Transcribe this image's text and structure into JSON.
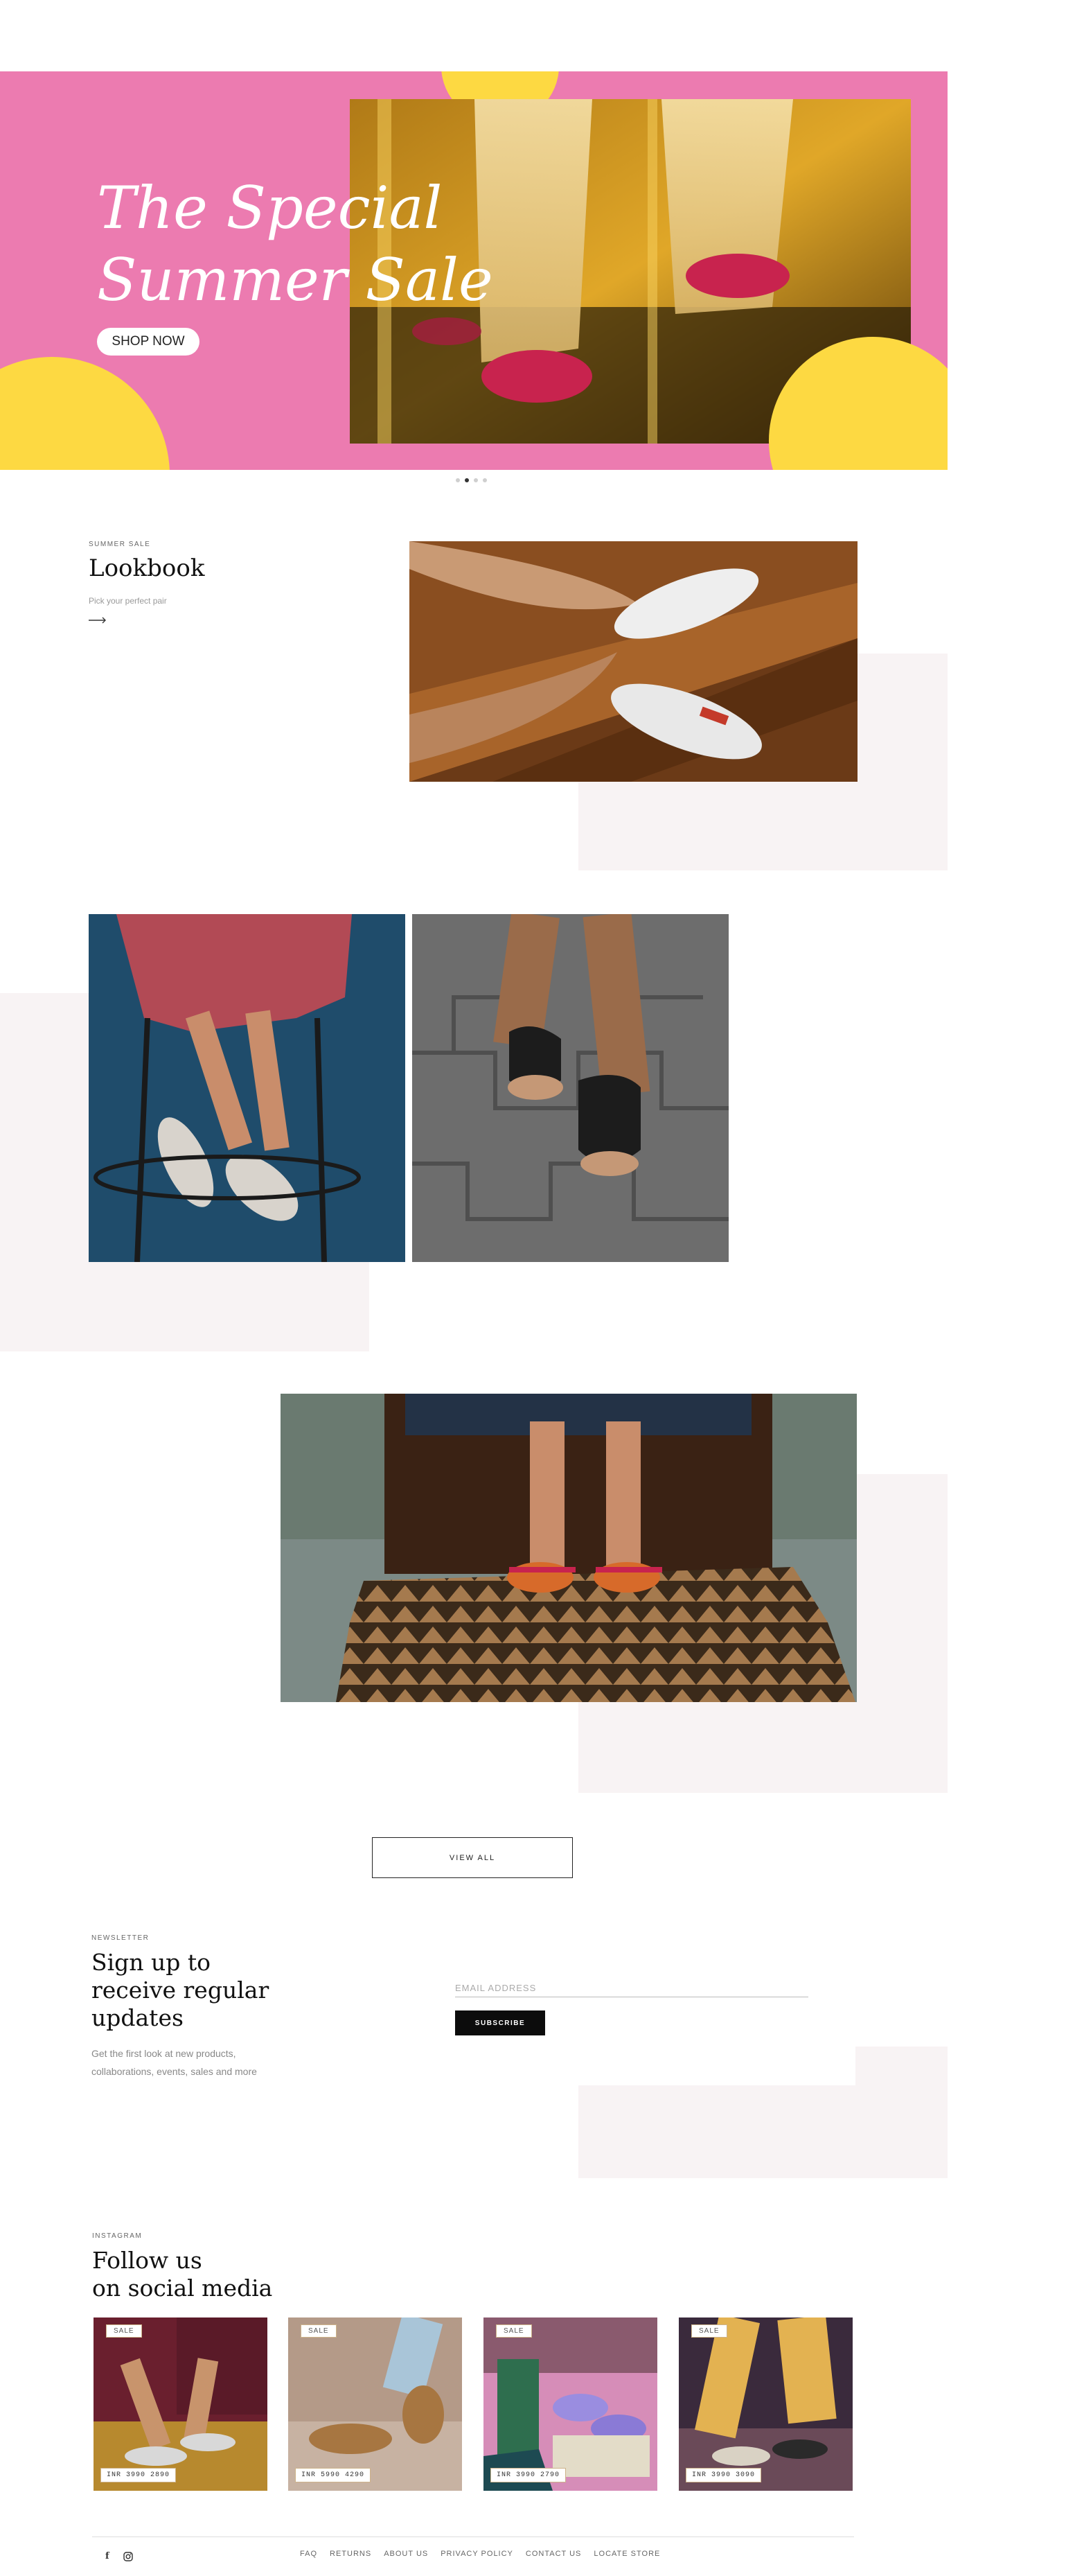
{
  "colors": {
    "hero_pink": "#ec7bb0",
    "hero_yellow": "#fdd942",
    "soft_block": "#f8f3f4",
    "ink": "#111111"
  },
  "hero": {
    "title": "The Special\nSummer Sale",
    "cta_label": "SHOP NOW",
    "carousel": {
      "slide_count": 4,
      "active_index": 1
    }
  },
  "lookbook": {
    "eyebrow": "SUMMER SALE",
    "title": "Lookbook",
    "subtitle": "Pick your perfect pair",
    "arrow_icon": "arrow-right-icon"
  },
  "view_all_label": "VIEW ALL",
  "newsletter": {
    "eyebrow": "NEWSLETTER",
    "title": "Sign up to\nreceive regular\nupdates",
    "description": "Get the first look at new products, collaborations, events, sales and more",
    "email_placeholder": "EMAIL ADDRESS",
    "subscribe_label": "SUBSCRIBE"
  },
  "instagram": {
    "eyebrow": "INSTAGRAM",
    "title": "Follow us\non social media",
    "posts": [
      {
        "sale": "SALE",
        "price": "INR 3990 2890"
      },
      {
        "sale": "SALE",
        "price": "INR 5990 4290"
      },
      {
        "sale": "SALE",
        "price": "INR 3990 2790"
      },
      {
        "sale": "SALE",
        "price": "INR 3990 3090"
      }
    ]
  },
  "footer": {
    "links": [
      "FAQ",
      "RETURNS",
      "ABOUT US",
      "PRIVACY POLICY",
      "CONTACT US",
      "LOCATE STORE"
    ],
    "social_icons": [
      "facebook-icon",
      "instagram-icon"
    ],
    "facebook_glyph": "f"
  }
}
